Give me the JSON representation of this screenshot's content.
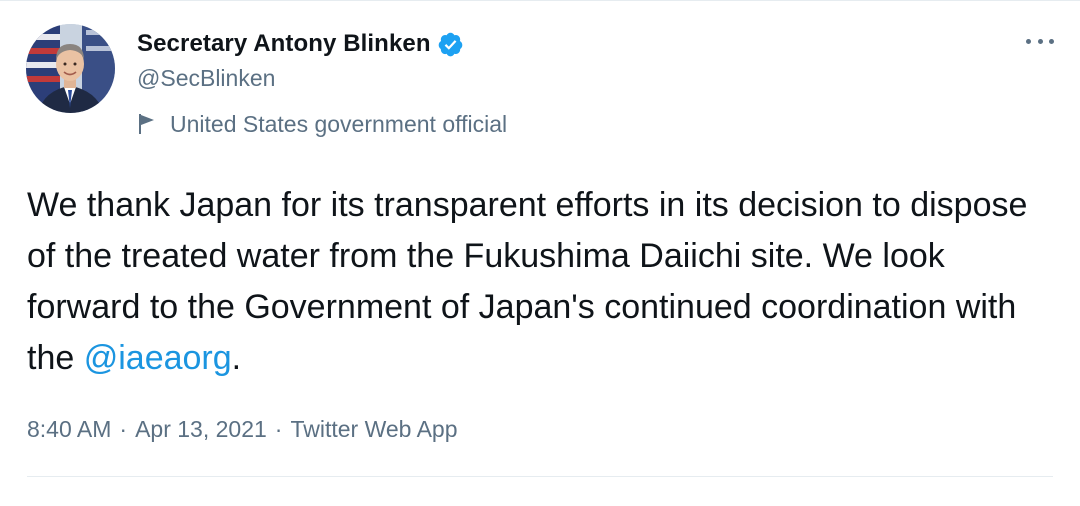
{
  "tweet": {
    "author": {
      "display_name": "Secretary Antony Blinken",
      "handle": "@SecBlinken",
      "label": "United States government official"
    },
    "text": {
      "before": "We thank Japan for its transparent efforts in its decision to dispose of the treated water from the Fukushima Daiichi site. We look forward to the Government of Japan's continued coordination with the ",
      "mention": "@iaeaorg",
      "after": "."
    },
    "meta": {
      "time": "8:40 AM",
      "date": "Apr 13, 2021",
      "source": "Twitter Web App",
      "separator": "·"
    }
  },
  "icons": {
    "verified": "verified-badge-icon",
    "flag": "flag-icon",
    "more": "more-options-icon"
  },
  "colors": {
    "link": "#1b95e0",
    "verified": "#1da1f2",
    "secondary_text": "#5b7083",
    "primary_text": "#0f1419"
  }
}
